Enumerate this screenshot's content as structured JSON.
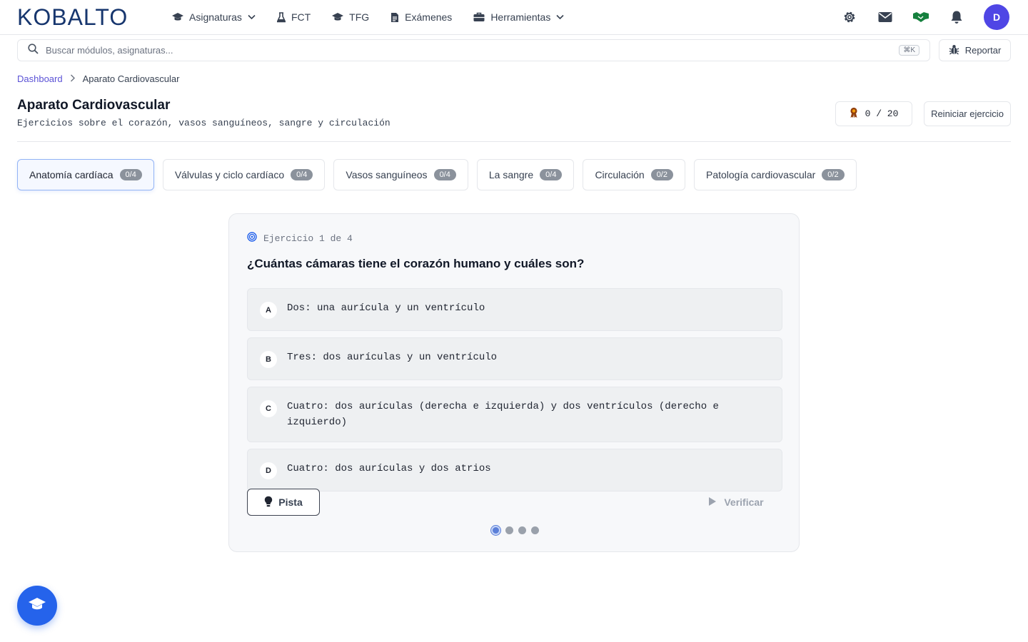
{
  "brand": {
    "logo_text": "KOBALTO"
  },
  "nav": {
    "items": [
      {
        "label": "Asignaturas",
        "icon": "graduation-cap-icon",
        "dropdown": true
      },
      {
        "label": "FCT",
        "icon": "flask-icon",
        "dropdown": false
      },
      {
        "label": "TFG",
        "icon": "graduation-cap-icon",
        "dropdown": false
      },
      {
        "label": "Exámenes",
        "icon": "document-icon",
        "dropdown": false
      },
      {
        "label": "Herramientas",
        "icon": "toolbox-icon",
        "dropdown": true
      }
    ],
    "right_icons": [
      "gear-icon",
      "mail-icon",
      "handshake-icon",
      "bell-icon"
    ],
    "avatar_initial": "D"
  },
  "search": {
    "placeholder": "Buscar módulos, asignaturas...",
    "value": "",
    "shortcut": "⌘K"
  },
  "report_button": {
    "label": "Reportar"
  },
  "breadcrumb": {
    "home": "Dashboard",
    "current": "Aparato Cardiovascular"
  },
  "header": {
    "title": "Aparato Cardiovascular",
    "subtitle": "Ejercicios sobre el corazón, vasos sanguíneos, sangre y circulación",
    "score": "0 / 20",
    "reset_label": "Reiniciar ejercicio"
  },
  "tabs": [
    {
      "label": "Anatomía cardíaca",
      "count": "0/4",
      "active": true
    },
    {
      "label": "Válvulas y ciclo cardíaco",
      "count": "0/4",
      "active": false
    },
    {
      "label": "Vasos sanguíneos",
      "count": "0/4",
      "active": false
    },
    {
      "label": "La sangre",
      "count": "0/4",
      "active": false
    },
    {
      "label": "Circulación",
      "count": "0/2",
      "active": false
    },
    {
      "label": "Patología cardiovascular",
      "count": "0/2",
      "active": false
    }
  ],
  "exercise": {
    "label": "Ejercicio 1 de 4",
    "question": "¿Cuántas cámaras tiene el corazón humano y cuáles son?",
    "options": [
      {
        "letter": "A",
        "text": "Dos: una aurícula y un ventrículo"
      },
      {
        "letter": "B",
        "text": "Tres: dos aurículas y un ventrículo"
      },
      {
        "letter": "C",
        "text": "Cuatro: dos aurículas (derecha e izquierda) y dos ventrículos (derecho e izquierdo)"
      },
      {
        "letter": "D",
        "text": "Cuatro: dos aurículas y dos atrios"
      }
    ],
    "hint_label": "Pista",
    "verify_label": "Verificar",
    "progress": {
      "current": 1,
      "total": 4
    }
  },
  "colors": {
    "accent": "#2563eb",
    "avatar": "#4f46e5",
    "breadcrumb_link": "#5b52d6",
    "badge": "#8b929c",
    "handshake": "#15803d",
    "award": "#92400e"
  }
}
